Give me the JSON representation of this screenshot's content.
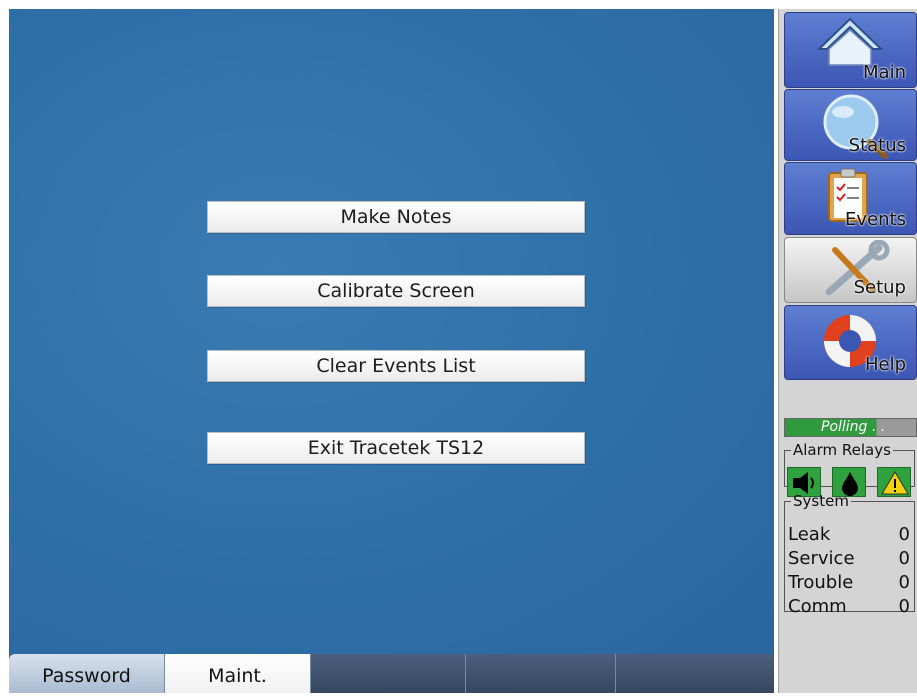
{
  "menu": {
    "make_notes": "Make Notes",
    "calibrate_screen": "Calibrate Screen",
    "clear_events": "Clear Events List",
    "exit": "Exit Tracetek TS12"
  },
  "tabs": {
    "password": "Password",
    "maint": "Maint.",
    "tab3": "",
    "tab4": "",
    "tab5": ""
  },
  "nav": {
    "main": "Main",
    "status": "Status",
    "events": "Events",
    "setup": "Setup",
    "help": "Help"
  },
  "polling": {
    "label": "Polling . ."
  },
  "alarm_relays": {
    "title": "Alarm Relays",
    "icons": [
      "horn-icon",
      "droplet-icon",
      "warning-icon"
    ]
  },
  "system": {
    "title": "System",
    "rows": [
      {
        "label": "Leak",
        "value": "0"
      },
      {
        "label": "Service",
        "value": "0"
      },
      {
        "label": "Trouble",
        "value": "0"
      },
      {
        "label": "Comm",
        "value": "0"
      }
    ]
  },
  "colors": {
    "main_panel": "#2f6fa8",
    "nav_blue": "#3c56b4",
    "relay_green": "#2fa13e"
  }
}
